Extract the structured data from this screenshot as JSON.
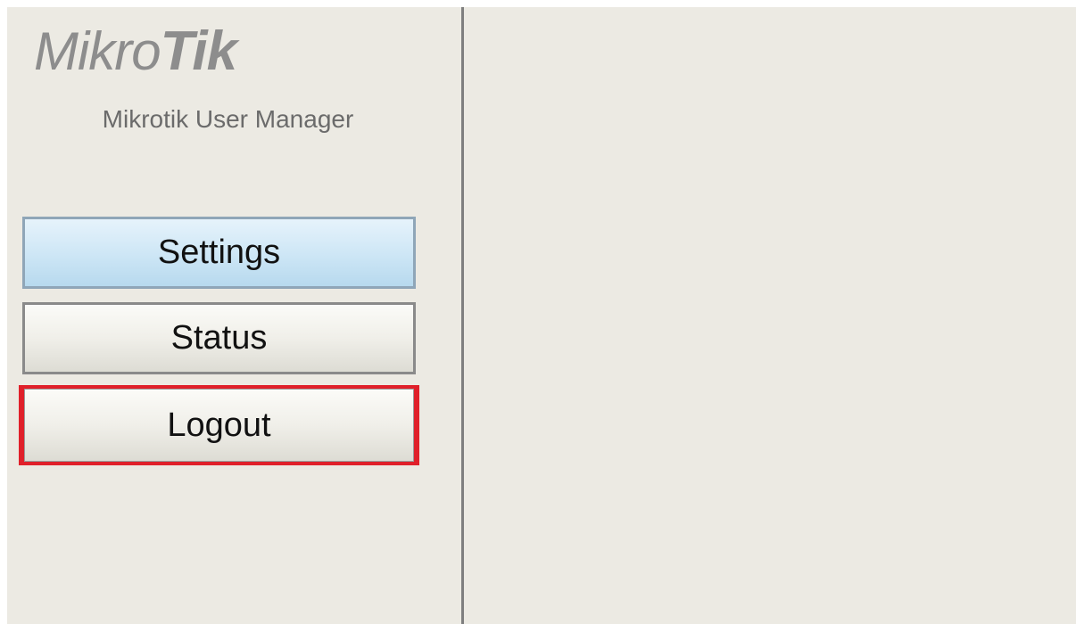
{
  "logo": {
    "light_text": "Mikro",
    "bold_text": "Tik"
  },
  "app": {
    "subtitle": "Mikrotik User Manager"
  },
  "menu": {
    "items": [
      {
        "label": "Settings",
        "state": "hover"
      },
      {
        "label": "Status",
        "state": "normal"
      },
      {
        "label": "Logout",
        "state": "highlighted"
      }
    ]
  },
  "colors": {
    "background": "#eceae3",
    "divider": "#7f7f7f",
    "highlight_border": "#e0202a",
    "settings_hover": "#cfe7f6"
  }
}
